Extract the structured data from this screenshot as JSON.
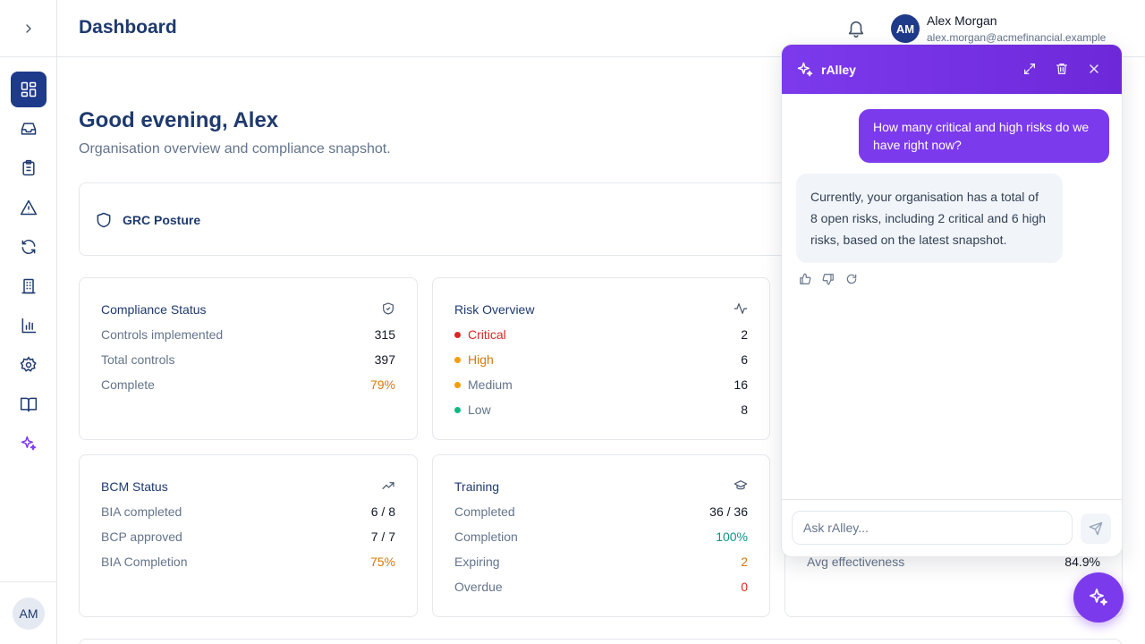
{
  "header": {
    "title": "Dashboard",
    "user": {
      "initials": "AM",
      "name": "Alex Morgan",
      "email": "alex.morgan@acmefinancial.example"
    }
  },
  "sidebar": {
    "items": [
      {
        "icon": "dashboard-icon",
        "active": true
      },
      {
        "icon": "inbox-icon"
      },
      {
        "icon": "clipboard-icon"
      },
      {
        "icon": "alert-triangle-icon"
      },
      {
        "icon": "refresh-icon"
      },
      {
        "icon": "building-icon"
      },
      {
        "icon": "bar-chart-icon"
      },
      {
        "icon": "gear-icon"
      },
      {
        "icon": "book-icon"
      },
      {
        "icon": "sparkles-icon"
      }
    ],
    "avatar_initials": "AM"
  },
  "main": {
    "greeting": "Good evening, Alex",
    "subtitle": "Organisation overview and compliance snapshot.",
    "posture_label": "GRC Posture",
    "compliance": {
      "title": "Compliance Status",
      "rows": [
        {
          "label": "Controls implemented",
          "value": "315"
        },
        {
          "label": "Total controls",
          "value": "397"
        },
        {
          "label": "Complete",
          "value": "79%"
        }
      ]
    },
    "risk": {
      "title": "Risk Overview",
      "rows": [
        {
          "label": "Critical",
          "value": "2",
          "color": "#dc2626"
        },
        {
          "label": "High",
          "value": "6",
          "color": "#d97706"
        },
        {
          "label": "Medium",
          "value": "16",
          "color": "#f59e0b"
        },
        {
          "label": "Low",
          "value": "8",
          "color": "#10b981"
        }
      ]
    },
    "bcm": {
      "title": "BCM Status",
      "rows": [
        {
          "label": "BIA completed",
          "value": "6 / 8"
        },
        {
          "label": "BCP approved",
          "value": "7 / 7"
        },
        {
          "label": "BIA Completion",
          "value": "75%"
        }
      ]
    },
    "training": {
      "title": "Training",
      "rows": [
        {
          "label": "Completed",
          "value": "36 / 36"
        },
        {
          "label": "Completion",
          "value": "100%"
        },
        {
          "label": "Expiring",
          "value": "2"
        },
        {
          "label": "Overdue",
          "value": "0"
        }
      ]
    },
    "partial_card": {
      "label": "Avg effectiveness",
      "value": "84.9%"
    }
  },
  "chat": {
    "title": "rAlley",
    "user_message": "How many critical and high risks do we have right now?",
    "bot_message": "Currently, your organisation has a total of 8 open risks, including 2 critical and 6 high risks, based on the latest snapshot.",
    "input_placeholder": "Ask rAlley..."
  },
  "colors": {
    "primary": "#1e3a8a",
    "accent": "#7c3aed",
    "critical": "#dc2626",
    "warning": "#d97706",
    "success": "#0d9488"
  }
}
